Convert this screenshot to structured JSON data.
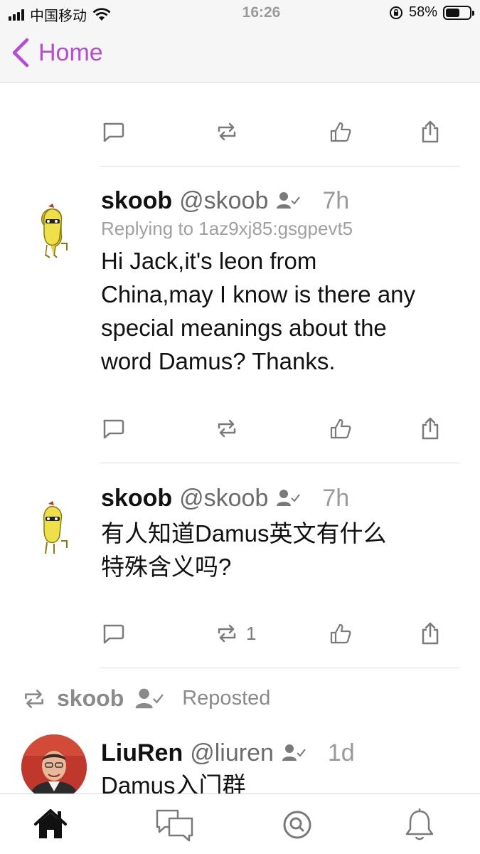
{
  "status_bar": {
    "carrier": "中国移动",
    "time": "16:26",
    "battery_percent": "58%",
    "battery_level": 0.58,
    "icons": [
      "signal-icon",
      "wifi-icon",
      "orientation-lock-icon",
      "battery-icon"
    ]
  },
  "nav": {
    "back_label": "Home",
    "accent_color": "#b54bd6"
  },
  "posts": [
    {
      "username": "skoob",
      "handle": "@skoob",
      "time": "7h",
      "replying_to": "Replying to 1az9xj85:gsgpevt5",
      "content_lines": [
        "Hi Jack,it's leon from",
        "China,may I know is there any",
        "special meanings about the",
        "word Damus? Thanks."
      ],
      "boost_count": ""
    },
    {
      "username": "skoob",
      "handle": "@skoob",
      "time": "7h",
      "replying_to": "",
      "content_lines": [
        "有人知道Damus英文有什么",
        "特殊含义吗?"
      ],
      "boost_count": "1"
    }
  ],
  "repost": {
    "reposter": "skoob",
    "label": "Reposted",
    "post": {
      "username": "LiuRen",
      "handle": "@liuren",
      "time": "1d",
      "content": "Damus入门群"
    }
  },
  "tabs": [
    {
      "name": "home",
      "icon": "home-icon"
    },
    {
      "name": "messages",
      "icon": "chat-bubbles-icon"
    },
    {
      "name": "search",
      "icon": "search-icon"
    },
    {
      "name": "notifications",
      "icon": "bell-icon"
    }
  ]
}
